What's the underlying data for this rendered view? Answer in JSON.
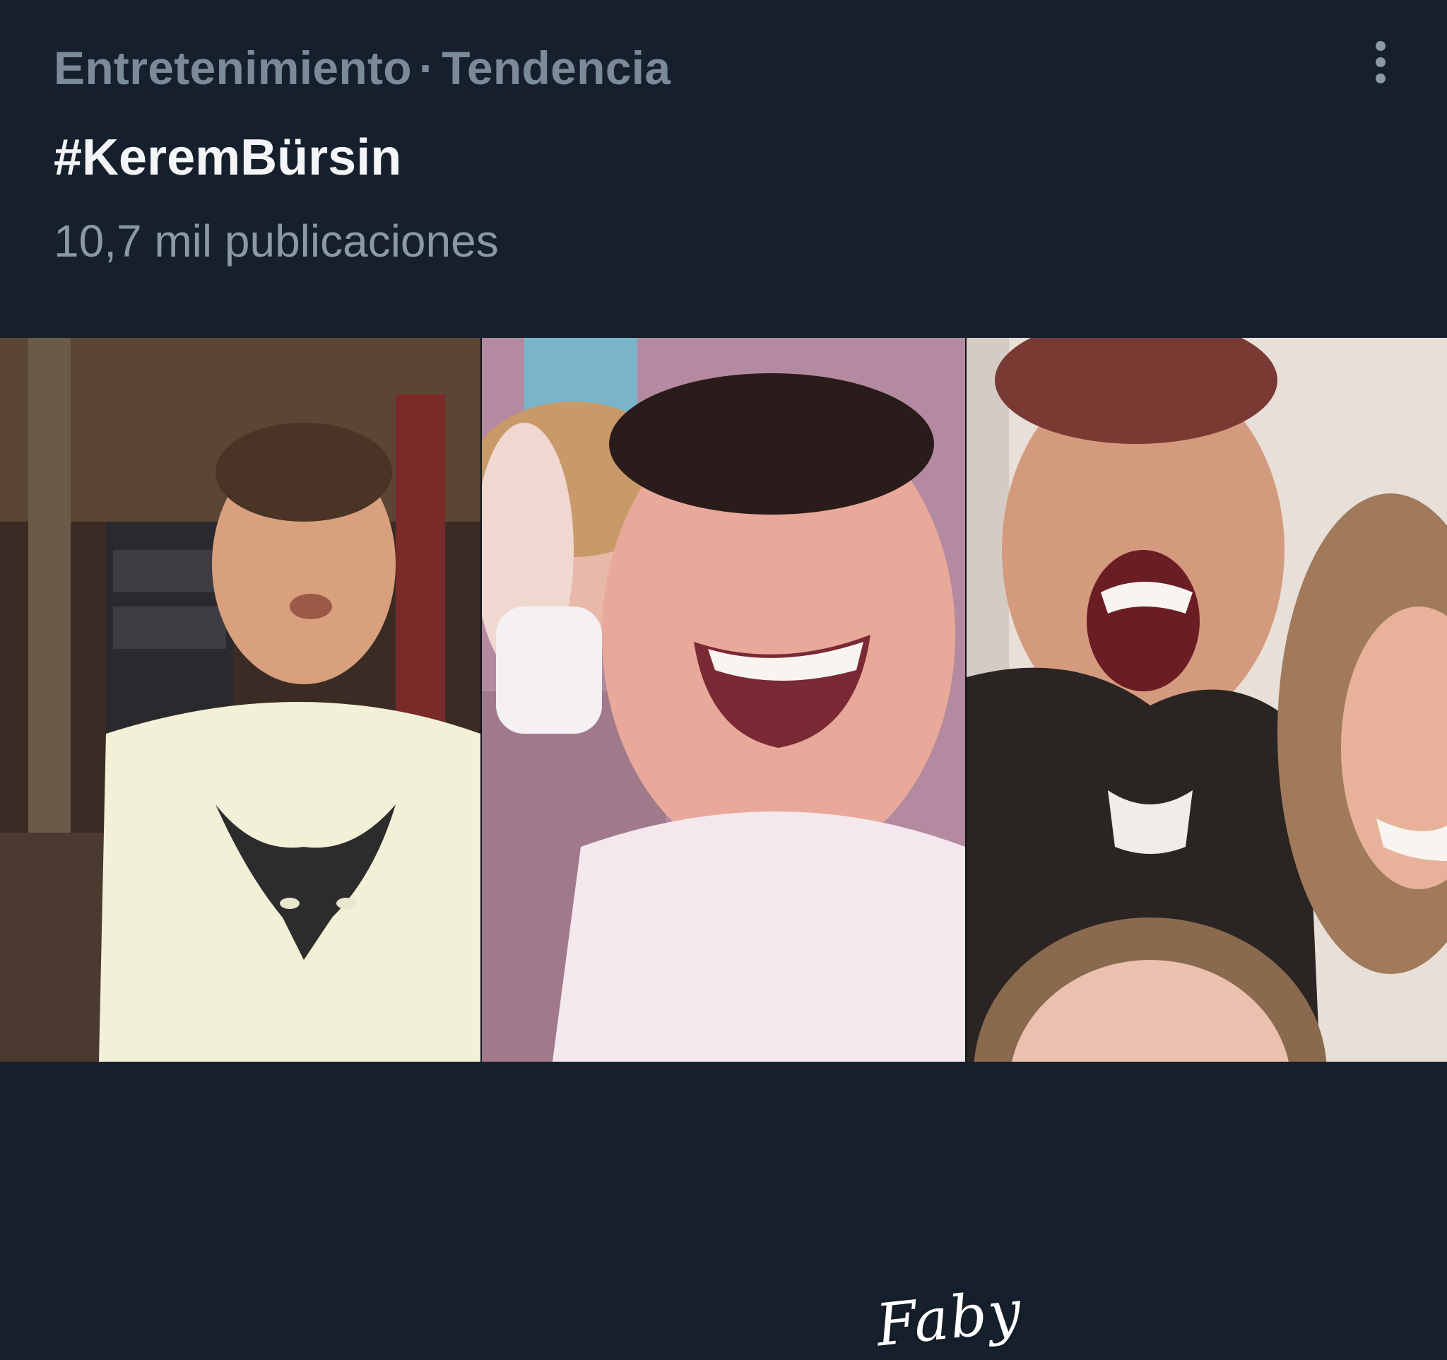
{
  "trend": {
    "category": "Entretenimiento",
    "separator": "·",
    "status": "Tendencia",
    "hashtag": "#KeremBürsin",
    "post_count": "10,7 mil publicaciones",
    "more_icon": "more-vertical-icon"
  },
  "media": {
    "watermark": "Faby"
  },
  "colors": {
    "background": "#16202c",
    "meta_text": "#7b8a99",
    "title_text": "#f3f5f7",
    "count_text": "#8b98a5"
  }
}
